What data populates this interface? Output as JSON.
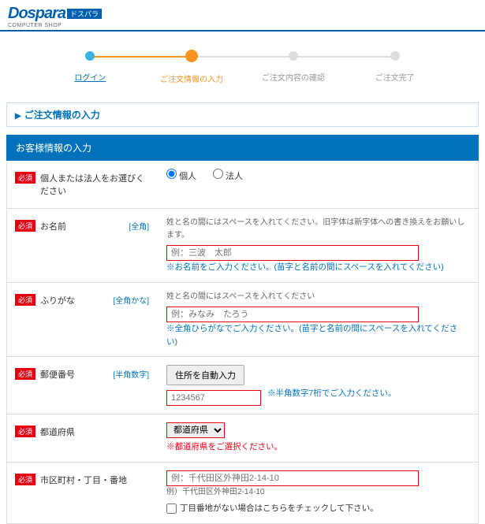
{
  "logo": {
    "main": "Dospara",
    "sub": "COMPUTER SHOP",
    "pill": "ドスパラ"
  },
  "steps": [
    {
      "label": "ログイン"
    },
    {
      "label": "ご注文情報の入力"
    },
    {
      "label": "ご注文内容の確認"
    },
    {
      "label": "ご注文完了"
    }
  ],
  "section_title": "ご注文情報の入力",
  "subsection_title": "お客様情報の入力",
  "required_badge": "必須",
  "rows": {
    "entity": {
      "label": "個人または法人をお選びください",
      "opt_personal": "個人",
      "opt_corp": "法人"
    },
    "name": {
      "label": "お名前",
      "hint": "[全角]",
      "desc": "姓と名の間にはスペースを入れてください。旧字体は新字体への書き換えをお願いします。",
      "placeholder": "例：三波　太郎",
      "error": "※お名前をご入力ください。(苗字と名前の間にスペースを入れてください)"
    },
    "kana": {
      "label": "ふりがな",
      "hint": "[全角かな]",
      "desc": "姓と名の間にはスペースを入れてください",
      "placeholder": "例：みなみ　たろう",
      "error": "※全角ひらがなでご入力ください。(苗字と名前の間にスペースを入れてください)"
    },
    "postal": {
      "label": "郵便番号",
      "hint": "[半角数字]",
      "btn": "住所を自動入力",
      "placeholder": "1234567",
      "note": "※半角数字7桁でご入力ください。"
    },
    "pref": {
      "label": "都道府県",
      "select": "都道府県",
      "error": "※都道府県をご選択ください。"
    },
    "city": {
      "label": "市区町村・丁目・番地",
      "placeholder": "例：千代田区外神田2-14-10",
      "example": "例）千代田区外神田2-14-10",
      "checkbox": "丁目番地がない場合はこちらをチェックして下さい。"
    }
  }
}
